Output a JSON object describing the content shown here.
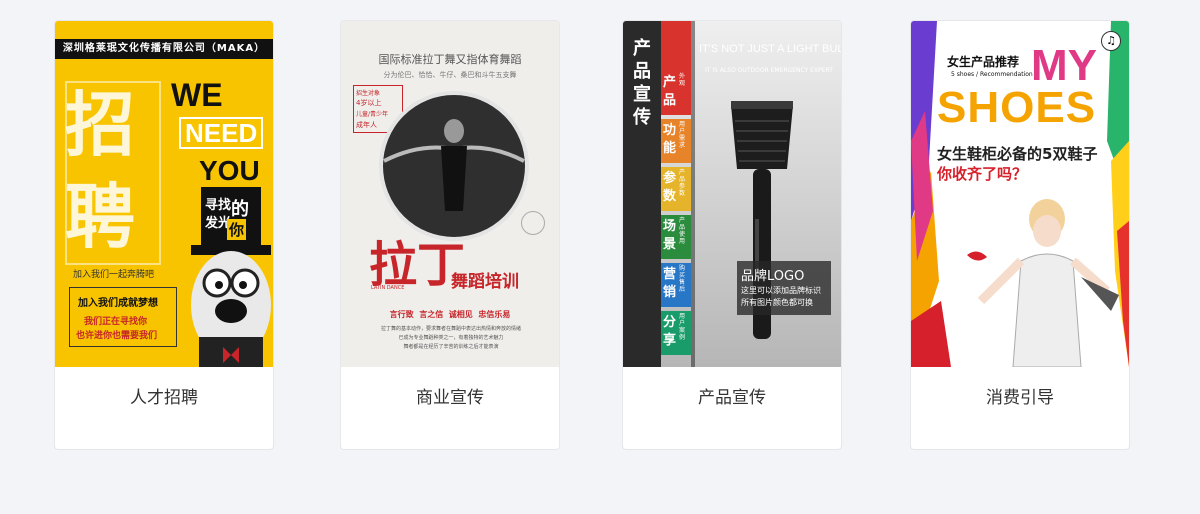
{
  "cards": [
    {
      "caption": "人才招聘",
      "poster": {
        "top_bar": "深圳格莱珉文化传播有限公司（MAKA）",
        "big_char_1": "招",
        "big_char_2": "聘",
        "we": "WE",
        "need": "NEED",
        "you": "YOU",
        "hat_1": "寻找",
        "hat_2": "发光",
        "hat_3": "的",
        "hat_4": "你",
        "slogan": "加入我们一起奔腾吧",
        "box_title": "加入我们成就梦想",
        "box_line1": "我们正在寻找你",
        "box_line2": "也许进你也需要我们"
      }
    },
    {
      "caption": "商业宣传",
      "poster": {
        "title": "国际标准拉丁舞又指体育舞蹈",
        "subtitle": "分为伦巴、恰恰、牛仔、桑巴和斗牛五支舞",
        "tag_1": "招生对象",
        "tag_2": "4岁以上",
        "tag_3": "儿童/青少年",
        "tag_4": "成年人",
        "big": "拉丁",
        "latin": "LATIN DANCE",
        "red_title": "舞蹈培训",
        "slogans": "言行致  言之信  诚相见  忠信乐易",
        "body_1": "拉丁舞的基本动作，要求舞者在舞蹈中表达出热情和奔放的情绪",
        "body_2": "已成为专业舞蹈种类之一，有着独特的艺术魅力",
        "body_3": "舞者都是在经历了辛苦的训练之后才能表演"
      }
    },
    {
      "caption": "产品宣传",
      "poster": {
        "headline": "IT'S NOT JUST A LIGHT BULB",
        "sub": "IT IS ALSO OUTDOOR EMERGENCY EXPERT",
        "vertical_title": "产品宣传",
        "features": [
          {
            "main": "产品",
            "side": "外观",
            "color": "#d8332c"
          },
          {
            "main": "功能",
            "side": "用户需求",
            "color": "#e7842a"
          },
          {
            "main": "参数",
            "side": "产品参数",
            "color": "#e5b42a"
          },
          {
            "main": "场景",
            "side": "产品使用",
            "color": "#2b8c3e"
          },
          {
            "main": "营销",
            "side": "购买售后",
            "color": "#2777c6"
          },
          {
            "main": "分享",
            "side": "用户案例",
            "color": "#1a9c6a"
          }
        ],
        "logo": "品牌LOGO",
        "logo_note_1": "这里可以添加品牌标识",
        "logo_note_2": "所有图片颜色都可换"
      }
    },
    {
      "caption": "消费引导",
      "poster": {
        "cn_title": "女生产品推荐",
        "en_title": "5 shoes / Recommendation",
        "my": "MY",
        "shoes": "SHOES",
        "line1": "女生鞋柜必备的5双鞋子",
        "line2": "你收齐了吗？"
      }
    }
  ],
  "colors": {
    "background": "#f3f4f8",
    "card_border": "#e6e7eb",
    "caption_text": "#333333",
    "yellow": "#f8c400",
    "red": "#c7252a"
  }
}
